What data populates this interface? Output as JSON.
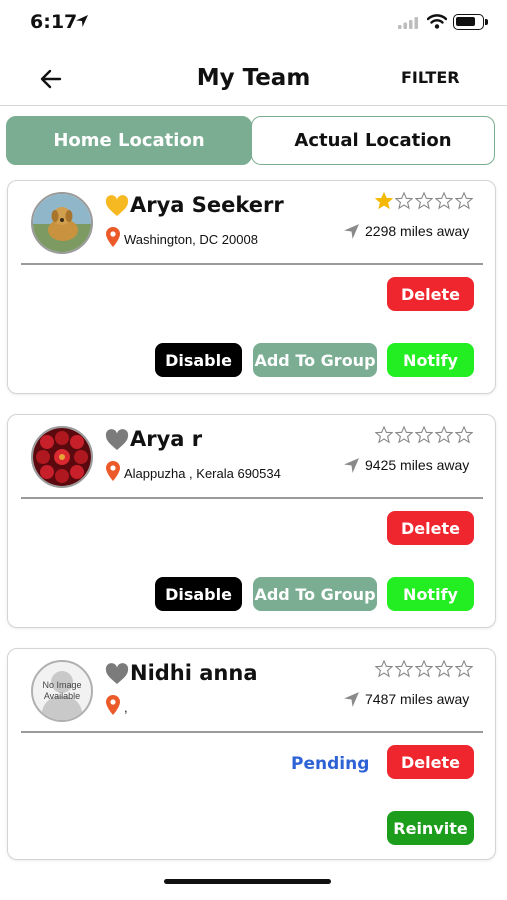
{
  "status_bar": {
    "time": "6:17"
  },
  "header": {
    "title": "My Team",
    "filter_label": "FILTER"
  },
  "tabs": [
    {
      "label": "Home Location",
      "selected": true
    },
    {
      "label": "Actual Location",
      "selected": false
    }
  ],
  "members": [
    {
      "name": "Arya Seekerr",
      "location": "Washington, DC 20008",
      "distance": "2298 miles away",
      "rating": 1,
      "favorite": true,
      "avatar": "dog-photo",
      "status": "",
      "actions": {
        "delete": "Delete",
        "disable": "Disable",
        "add_group": "Add To Group",
        "notify": "Notify"
      }
    },
    {
      "name": "Arya r",
      "location": "Alappuzha , Kerala  690534",
      "distance": "9425 miles away",
      "rating": 0,
      "favorite": false,
      "avatar": "roses-photo",
      "status": "",
      "actions": {
        "delete": "Delete",
        "disable": "Disable",
        "add_group": "Add To Group",
        "notify": "Notify"
      }
    },
    {
      "name": "Nidhi anna",
      "location": ",",
      "distance": "7487 miles away",
      "rating": 0,
      "favorite": false,
      "avatar": "placeholder",
      "avatar_text": "No Image Available",
      "status": "Pending",
      "actions": {
        "delete": "Delete",
        "reinvite": "Reinvite"
      }
    }
  ],
  "colors": {
    "accent_green": "#7aad91",
    "delete_red": "#f0262f",
    "notify_green": "#22ee22",
    "reinvite_green": "#1c9e1c",
    "pending_blue": "#2e63d6",
    "star_gold": "#f5b800",
    "favorite_heart": "#f6b922",
    "pin_orange": "#ec5a2a"
  }
}
